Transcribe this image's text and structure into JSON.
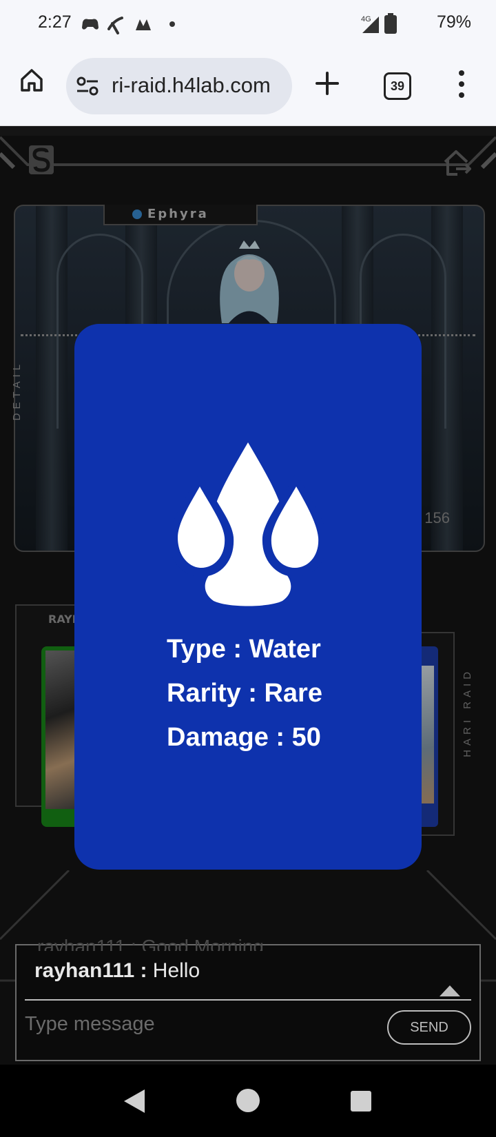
{
  "status_bar": {
    "time": "2:27",
    "signal_label": "4G",
    "battery": "79%"
  },
  "browser": {
    "url": "ri-raid.h4lab.com",
    "tab_count": "39"
  },
  "game": {
    "character_name": "Ephyra",
    "side_label_left": "DETAIL",
    "side_label_right": "HARI RAID",
    "counter": "/ 156",
    "left_card_label": "RAYI",
    "element_color": "#0e32ad"
  },
  "modal": {
    "type_line": "Type : Water",
    "rarity_line": "Rarity : Rare",
    "damage_line": "Damage : 50",
    "icon": "water-drops-icon"
  },
  "chat": {
    "faded_message": "rayhan111 : Good Morning",
    "username": "rayhan111",
    "separator": " : ",
    "message": "Hello",
    "placeholder": "Type message",
    "send_label": "SEND"
  }
}
